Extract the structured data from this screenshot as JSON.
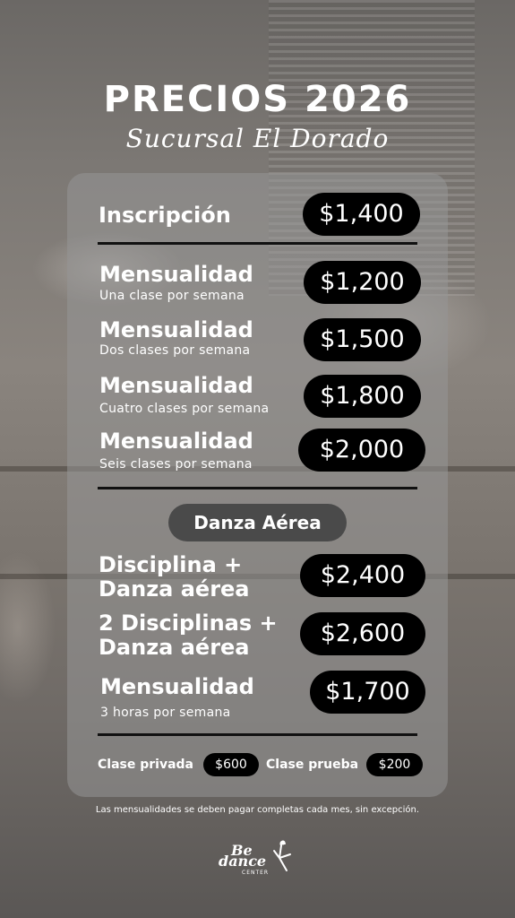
{
  "title": "PRECIOS 2026",
  "subtitle": "Sucursal El Dorado",
  "inscripcion": {
    "label": "Inscripción",
    "price": "$1,400"
  },
  "mensualidades": [
    {
      "label": "Mensualidad",
      "sub": "Una clase por semana",
      "price": "$1,200"
    },
    {
      "label": "Mensualidad",
      "sub": "Dos clases por semana",
      "price": "$1,500"
    },
    {
      "label": "Mensualidad",
      "sub": "Cuatro clases por semana",
      "price": "$1,800"
    },
    {
      "label": "Mensualidad",
      "sub": "Seis clases por semana",
      "price": "$2,000"
    }
  ],
  "section_label": "Danza Aérea",
  "aerea": [
    {
      "line1": "Disciplina +",
      "line2": "Danza aérea",
      "price": "$2,400"
    },
    {
      "line1": "2 Disciplinas +",
      "line2": "Danza aérea",
      "price": "$2,600"
    },
    {
      "label": "Mensualidad",
      "sub": "3 horas por semana",
      "price": "$1,700"
    }
  ],
  "extras": {
    "privada_label": "Clase privada",
    "privada_price": "$600",
    "prueba_label": "Clase prueba",
    "prueba_price": "$200"
  },
  "note": "Las mensualidades se deben pagar completas cada mes, sin excepción.",
  "logo": {
    "line1": "Be",
    "line2": "dance",
    "line3": "CENTER"
  }
}
